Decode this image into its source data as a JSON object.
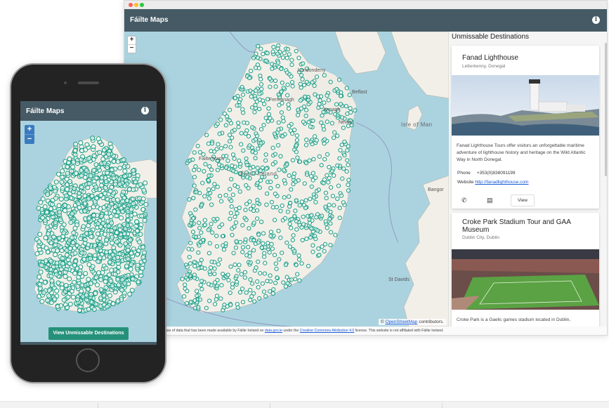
{
  "desktop": {
    "app_title": "Fáilte Maps",
    "info_icon": "info-icon",
    "map": {
      "zoom_in": "+",
      "zoom_out": "−",
      "labels": {
        "derry": "Londonderry",
        "belfast": "Belfast",
        "armagh": "Armagh",
        "newry": "Newry",
        "fermanagh": "Fermanagh",
        "isle_of_man": "Isle of Man",
        "eire": "Éire / Ireland",
        "failte": "Fáilte Maps",
        "bangor": "Bangor",
        "st_davids": "St Davids"
      },
      "attribution_prefix": "©",
      "attribution_link": "OpenStreetMap",
      "attribution_suffix": "contributors."
    },
    "footer": {
      "prefix": "use of data that has been made available by Fáilte Ireland on",
      "link1": "data.gov.ie",
      "middle": "under the",
      "link2": "Creative Commons Attribution 4.0",
      "suffix": "license. This website is not affiliated with Fáilte Ireland."
    },
    "panel": {
      "title": "Unmissable Destinations",
      "cards": [
        {
          "title": "Fanad Lighthouse",
          "subtitle": "Letterkenny, Donegal",
          "description": "Fanad Lighthouse Tours offer visitors an unforgettable maritime adventure of lighthouse history and heritage on the Wild Atlantic Way in North Donegal.",
          "phone_label": "Phone",
          "phone": "+353(0)838091199",
          "website_label": "Website",
          "website": "http://fanadlighthouse.com",
          "view_label": "View",
          "call_icon": "phone-icon",
          "calendar_icon": "calendar-icon"
        },
        {
          "title": "Croke Park Stadium Tour and GAA Museum",
          "subtitle": "Dublin City, Dublin",
          "description": "Croke Park is a Gaelic games stadium located in Dublin,"
        }
      ]
    }
  },
  "phone": {
    "app_title": "Fáilte Maps",
    "info_icon": "info-icon",
    "zoom_in": "+",
    "zoom_out": "−",
    "cta_label": "View Unmissable Destinations"
  },
  "colors": {
    "app_bar": "#455a64",
    "marker": "#1a9e85",
    "cta": "#26917a",
    "sea": "#aad3df",
    "land": "#f2efe9"
  }
}
